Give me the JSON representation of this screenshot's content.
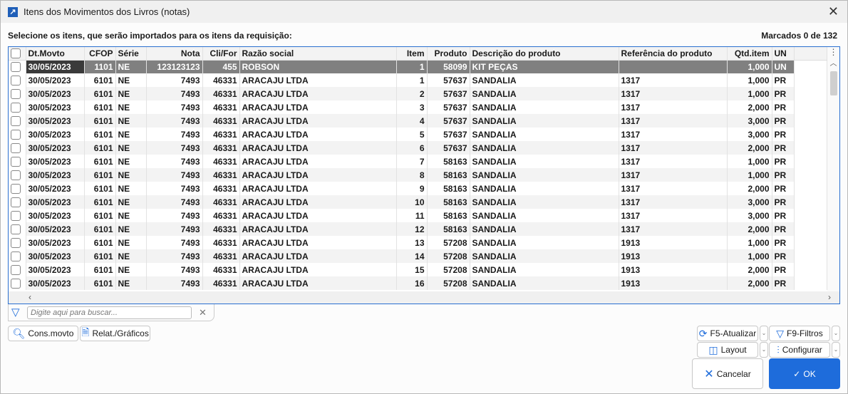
{
  "window": {
    "title": "Itens dos Movimentos dos Livros (notas)"
  },
  "instruction": "Selecione os itens, que serão importados para os itens da requisição:",
  "marked_count": "Marcados 0 de 132",
  "columns": [
    "Dt.Movto",
    "CFOP",
    "Série",
    "Nota",
    "Cli/For",
    "Razão social",
    "Item",
    "Produto",
    "Descrição do produto",
    "Referência do produto",
    "Qtd.item",
    "UN"
  ],
  "rows": [
    [
      "30/05/2023",
      "1101",
      "NE",
      "123123123",
      "455",
      "ROBSON",
      "1",
      "58099",
      "KIT PEÇAS",
      "",
      "1,000",
      "UN"
    ],
    [
      "30/05/2023",
      "6101",
      "NE",
      "7493",
      "46331",
      "ARACAJU LTDA",
      "1",
      "57637",
      "SANDALIA",
      "1317",
      "1,000",
      "PR"
    ],
    [
      "30/05/2023",
      "6101",
      "NE",
      "7493",
      "46331",
      "ARACAJU LTDA",
      "2",
      "57637",
      "SANDALIA",
      "1317",
      "1,000",
      "PR"
    ],
    [
      "30/05/2023",
      "6101",
      "NE",
      "7493",
      "46331",
      "ARACAJU LTDA",
      "3",
      "57637",
      "SANDALIA",
      "1317",
      "2,000",
      "PR"
    ],
    [
      "30/05/2023",
      "6101",
      "NE",
      "7493",
      "46331",
      "ARACAJU LTDA",
      "4",
      "57637",
      "SANDALIA",
      "1317",
      "3,000",
      "PR"
    ],
    [
      "30/05/2023",
      "6101",
      "NE",
      "7493",
      "46331",
      "ARACAJU LTDA",
      "5",
      "57637",
      "SANDALIA",
      "1317",
      "3,000",
      "PR"
    ],
    [
      "30/05/2023",
      "6101",
      "NE",
      "7493",
      "46331",
      "ARACAJU LTDA",
      "6",
      "57637",
      "SANDALIA",
      "1317",
      "2,000",
      "PR"
    ],
    [
      "30/05/2023",
      "6101",
      "NE",
      "7493",
      "46331",
      "ARACAJU LTDA",
      "7",
      "58163",
      "SANDALIA",
      "1317",
      "1,000",
      "PR"
    ],
    [
      "30/05/2023",
      "6101",
      "NE",
      "7493",
      "46331",
      "ARACAJU LTDA",
      "8",
      "58163",
      "SANDALIA",
      "1317",
      "1,000",
      "PR"
    ],
    [
      "30/05/2023",
      "6101",
      "NE",
      "7493",
      "46331",
      "ARACAJU LTDA",
      "9",
      "58163",
      "SANDALIA",
      "1317",
      "2,000",
      "PR"
    ],
    [
      "30/05/2023",
      "6101",
      "NE",
      "7493",
      "46331",
      "ARACAJU LTDA",
      "10",
      "58163",
      "SANDALIA",
      "1317",
      "3,000",
      "PR"
    ],
    [
      "30/05/2023",
      "6101",
      "NE",
      "7493",
      "46331",
      "ARACAJU LTDA",
      "11",
      "58163",
      "SANDALIA",
      "1317",
      "3,000",
      "PR"
    ],
    [
      "30/05/2023",
      "6101",
      "NE",
      "7493",
      "46331",
      "ARACAJU LTDA",
      "12",
      "58163",
      "SANDALIA",
      "1317",
      "2,000",
      "PR"
    ],
    [
      "30/05/2023",
      "6101",
      "NE",
      "7493",
      "46331",
      "ARACAJU LTDA",
      "13",
      "57208",
      "SANDALIA",
      "1913",
      "1,000",
      "PR"
    ],
    [
      "30/05/2023",
      "6101",
      "NE",
      "7493",
      "46331",
      "ARACAJU LTDA",
      "14",
      "57208",
      "SANDALIA",
      "1913",
      "1,000",
      "PR"
    ],
    [
      "30/05/2023",
      "6101",
      "NE",
      "7493",
      "46331",
      "ARACAJU LTDA",
      "15",
      "57208",
      "SANDALIA",
      "1913",
      "2,000",
      "PR"
    ],
    [
      "30/05/2023",
      "6101",
      "NE",
      "7493",
      "46331",
      "ARACAJU LTDA",
      "16",
      "57208",
      "SANDALIA",
      "1913",
      "2,000",
      "PR"
    ]
  ],
  "search": {
    "placeholder": "Digite aqui para buscar..."
  },
  "buttons": {
    "cons": "Cons.movto",
    "relat": "Relat./Gráficos",
    "atualizar": "F5-Atualizar",
    "filtros": "F9-Filtros",
    "layout": "Layout",
    "configurar": "Configurar",
    "cancelar": "Cancelar",
    "ok": "OK"
  },
  "colors": {
    "accent": "#1e6cdb",
    "selected_row": "#808080"
  }
}
